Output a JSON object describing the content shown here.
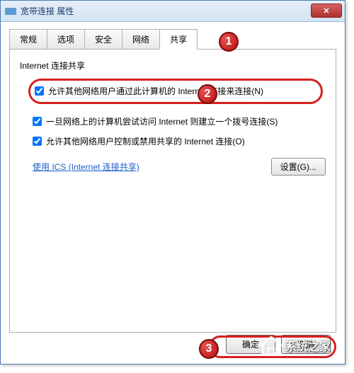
{
  "window": {
    "title": "宽带连接 属性"
  },
  "tabs": {
    "items": [
      {
        "label": "常规"
      },
      {
        "label": "选项"
      },
      {
        "label": "安全"
      },
      {
        "label": "网络"
      },
      {
        "label": "共享"
      }
    ]
  },
  "group": {
    "title": "Internet 连接共享"
  },
  "checkboxes": {
    "allow_share": "允许其他网络用户通过此计算机的 Internet 连接来连接(N)",
    "dial_on_demand": "一旦网络上的计算机尝试访问 Internet 则建立一个拨号连接(S)",
    "allow_control": "允许其他网络用户控制或禁用共享的 Internet 连接(O)"
  },
  "link": {
    "ics_label": "使用 ICS (Internet 连接共享)"
  },
  "buttons": {
    "settings": "设置(G)...",
    "ok": "确定",
    "cancel": "取消"
  },
  "badges": {
    "one": "1",
    "two": "2",
    "three": "3"
  },
  "watermark": {
    "text": "系统之家"
  }
}
